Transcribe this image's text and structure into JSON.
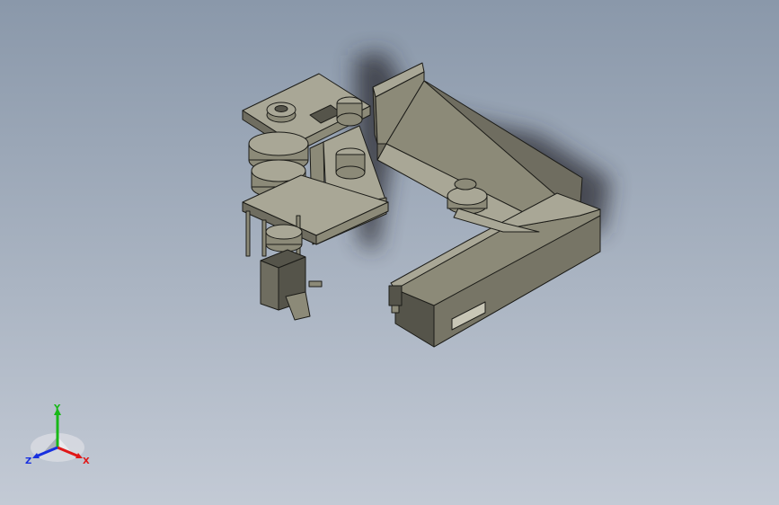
{
  "viewport": {
    "background_top": "#8a98aa",
    "background_bottom": "#c3cad5"
  },
  "model": {
    "part_color": "#8c8a78",
    "part_top_color": "#a9a796",
    "part_dark_color": "#55544a",
    "edge_color": "#1c1c18",
    "shadow_color": "#2a2a30"
  },
  "triad": {
    "x_label": "X",
    "y_label": "Y",
    "z_label": "Z",
    "x_color": "#e01818",
    "y_color": "#18b818",
    "z_color": "#1830e0"
  }
}
